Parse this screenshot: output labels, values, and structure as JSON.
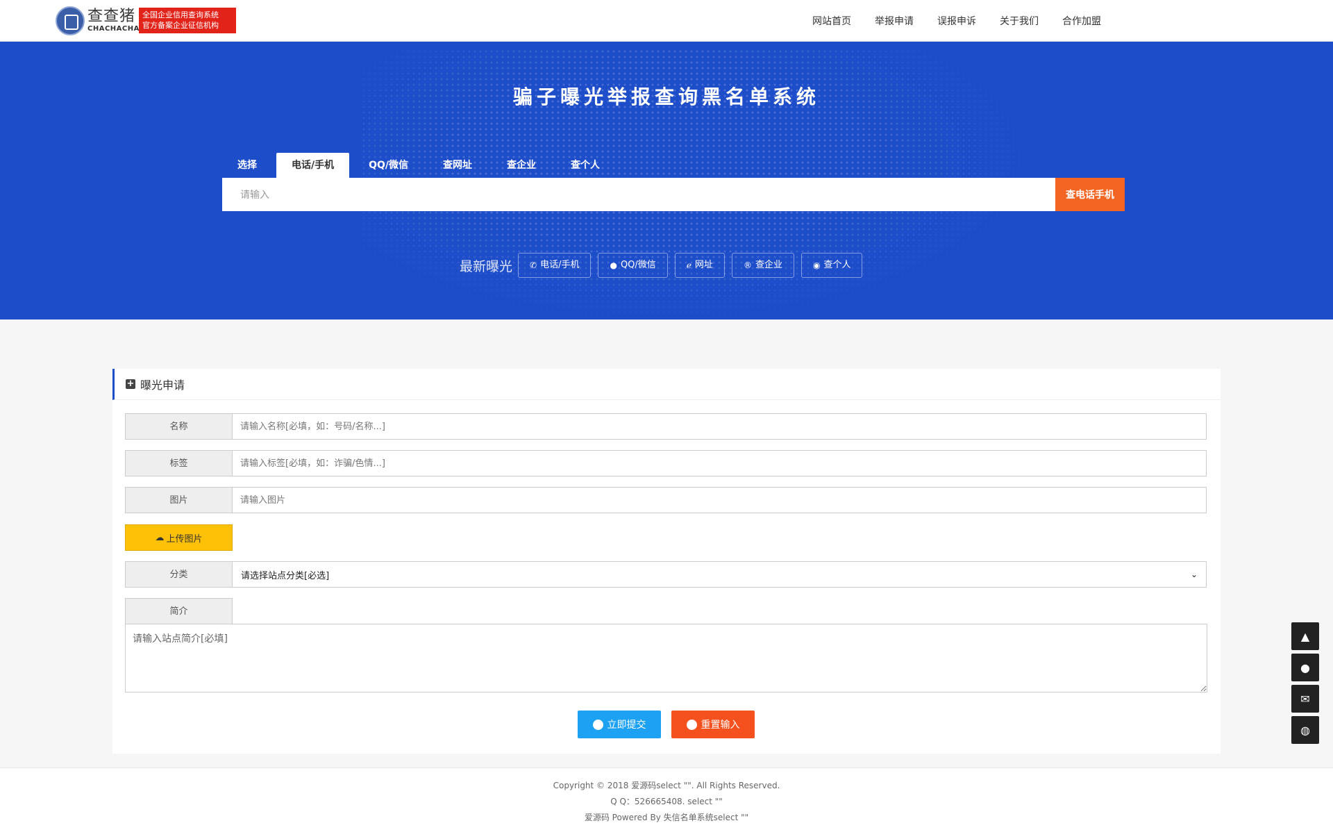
{
  "header": {
    "logo": {
      "cn": "查查猪",
      "en": "CHACHACHA",
      "tag_line1": "全国企业信用查询系统",
      "tag_line2": "官方备案企业征信机构"
    },
    "nav": [
      "网站首页",
      "举报申请",
      "误报申诉",
      "关于我们",
      "合作加盟"
    ]
  },
  "banner": {
    "title": "骗子曝光举报查询黑名单系统",
    "tabs": [
      "选择",
      "电话/手机",
      "QQ/微信",
      "查网址",
      "查企业",
      "查个人"
    ],
    "active_tab": "电话/手机",
    "search_placeholder": "请输入",
    "search_button": "查电话手机",
    "latest_label": "最新曝光",
    "latest_links": [
      {
        "label": "电话/手机",
        "icon": "whatsapp-icon"
      },
      {
        "label": "QQ/微信",
        "icon": "wechat-icon"
      },
      {
        "label": "网址",
        "icon": "ie-icon"
      },
      {
        "label": "查企业",
        "icon": "registered-icon"
      },
      {
        "label": "查个人",
        "icon": "user-circle-icon"
      }
    ]
  },
  "form": {
    "title": "曝光申请",
    "name": {
      "label": "名称",
      "placeholder": "请输入名称[必填，如：号码/名称...]"
    },
    "tag": {
      "label": "标签",
      "placeholder": "请输入标签[必填，如：诈骗/色情...]"
    },
    "image": {
      "label": "图片",
      "placeholder": "请输入图片"
    },
    "upload_label": "上传图片",
    "category": {
      "label": "分类",
      "value": "请选择站点分类[必选]"
    },
    "intro": {
      "label": "简介",
      "placeholder": "请输入站点简介[必填]"
    },
    "submit_label": "立即提交",
    "reset_label": "重置输入"
  },
  "footer": {
    "line1": "Copyright © 2018 爱源码select \"\". All Rights Reserved.",
    "line2": "Q Q：526665408. select \"\"",
    "line3": "爱源码 Powered By 失信名单系统select \"\""
  },
  "colors": {
    "banner": "#1e4dc9",
    "search_button": "#f26522",
    "upload": "#ffc107",
    "submit": "#1da1f2",
    "reset": "#f4511e"
  }
}
